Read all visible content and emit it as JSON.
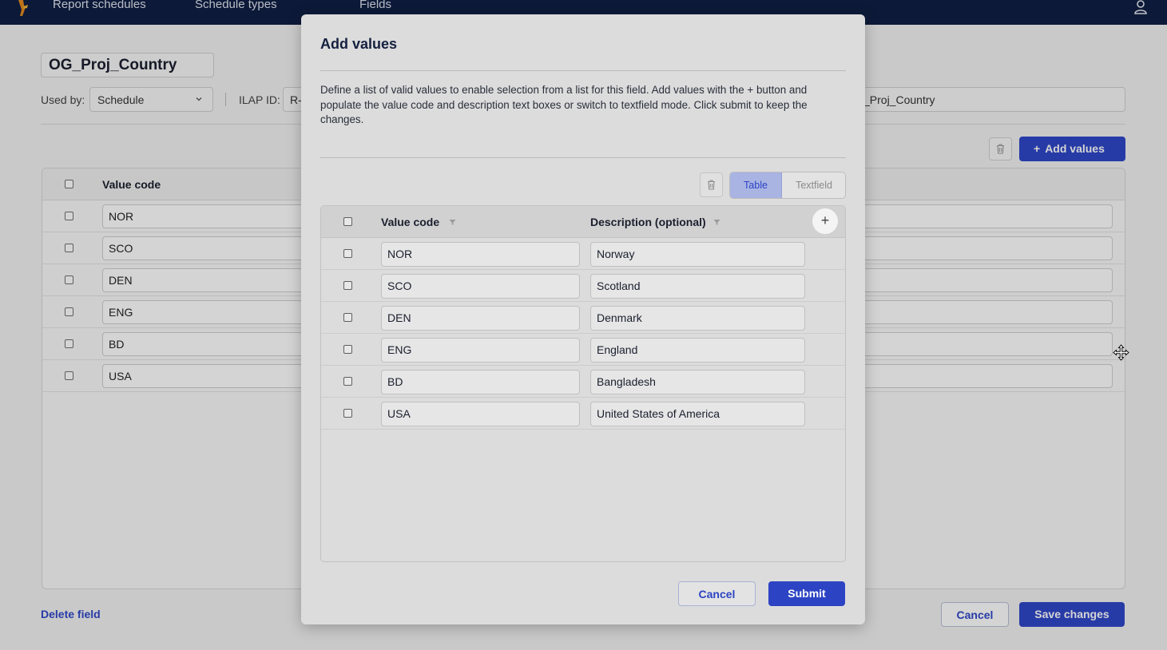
{
  "nav": {
    "items": [
      "Report schedules",
      "Schedule types",
      "Fields"
    ]
  },
  "page": {
    "title": "OG_Proj_Country",
    "used_by_label": "Used by:",
    "used_by_value": "Schedule",
    "ilap_label": "ILAP ID:",
    "ilap_value": "R-",
    "name_value": "OG_Proj_Country",
    "name_visible": "_Proj_Country",
    "add_values_label": "Add values",
    "table_header": "Value code",
    "rows": [
      "NOR",
      "SCO",
      "DEN",
      "ENG",
      "BD",
      "USA"
    ],
    "delete_field_label": "Delete field",
    "cancel_label": "Cancel",
    "save_label": "Save changes"
  },
  "modal": {
    "title": "Add values",
    "description": "Define a list of valid values to enable selection from a list for this field. Add values with the + button and populate the value code and description text boxes or switch to textfield mode. Click submit to keep the changes.",
    "mode_table_label": "Table",
    "mode_textfield_label": "Textfield",
    "selected_mode": "Table",
    "col_code": "Value code",
    "col_description": "Description (optional)",
    "add_row_symbol": "+",
    "rows": [
      {
        "code": "NOR",
        "description": "Norway"
      },
      {
        "code": "SCO",
        "description": "Scotland"
      },
      {
        "code": "DEN",
        "description": "Denmark"
      },
      {
        "code": "ENG",
        "description": "England"
      },
      {
        "code": "BD",
        "description": "Bangladesh"
      },
      {
        "code": "USA",
        "description": "United States of America"
      }
    ],
    "cancel_label": "Cancel",
    "submit_label": "Submit"
  },
  "colors": {
    "nav_bg": "#0f1f44",
    "accent": "#2c44c3"
  }
}
